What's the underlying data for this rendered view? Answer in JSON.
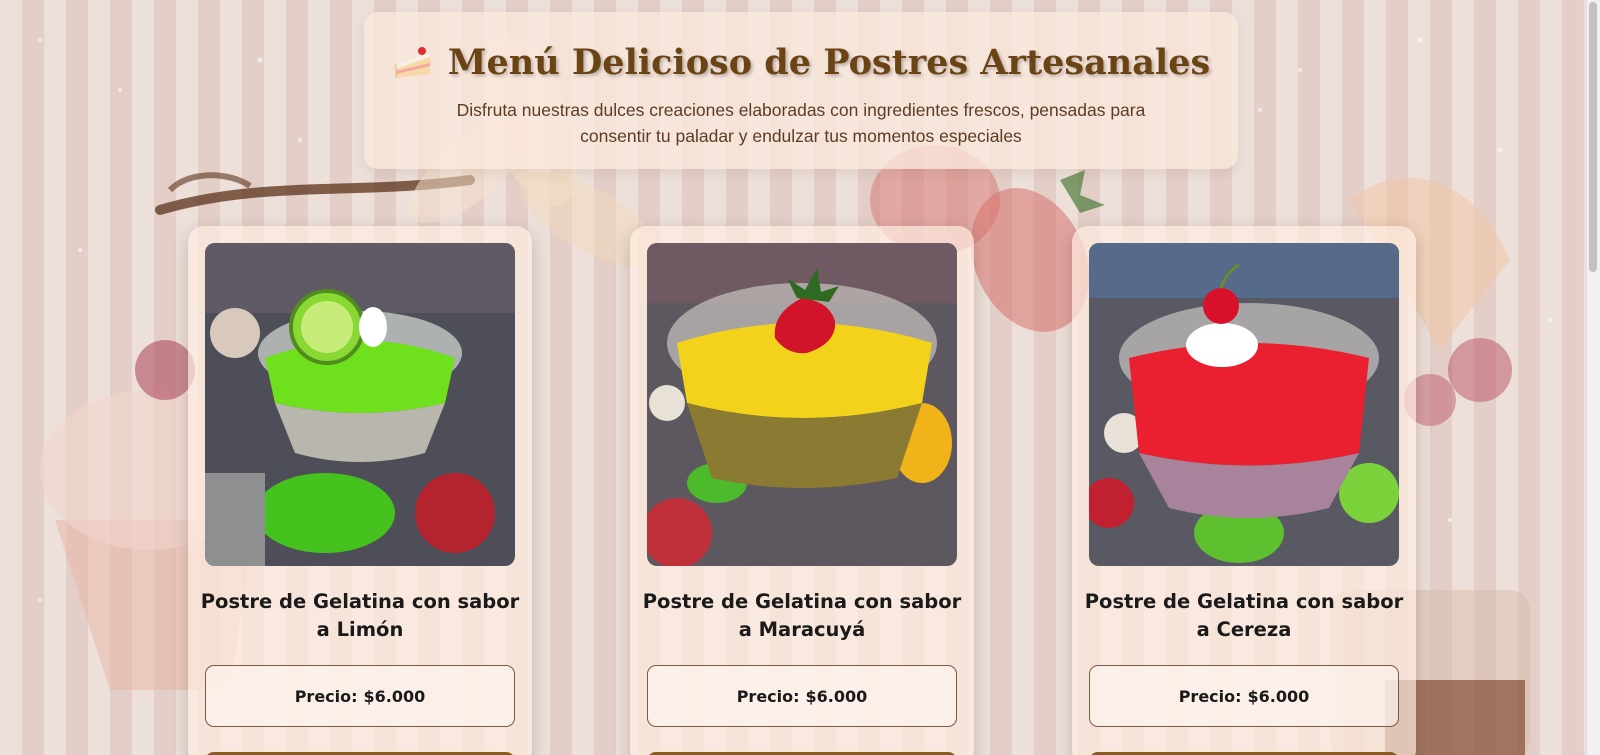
{
  "header": {
    "icon": "cake-icon",
    "title": "Menú Delicioso de Postres Artesanales",
    "subtitle": "Disfruta nuestras dulces creaciones elaboradas con ingredientes frescos, pensadas para consentir tu paladar y endulzar tus momentos especiales"
  },
  "products": [
    {
      "title": "Postre de Gelatina con sabor a Limón",
      "price_label": "Precio:",
      "price": "$6.000",
      "topping": "lime-icon",
      "colors": {
        "top": "#6ee01c",
        "bottom": "#b9b7ad"
      }
    },
    {
      "title": "Postre de Gelatina con sabor a Maracuyá",
      "price_label": "Precio:",
      "price": "$6.000",
      "topping": "strawberry-icon",
      "colors": {
        "top": "#f2d21a",
        "bottom": "#8a7a32"
      }
    },
    {
      "title": "Postre de Gelatina con sabor a Cereza",
      "price_label": "Precio:",
      "price": "$6.000",
      "topping": "cherry-icon",
      "colors": {
        "top": "#ea1f2f",
        "bottom": "#a7839c"
      }
    }
  ],
  "colors": {
    "title": "#6b4415",
    "button": "#8b5a1f",
    "background": "#e3cfc8"
  }
}
